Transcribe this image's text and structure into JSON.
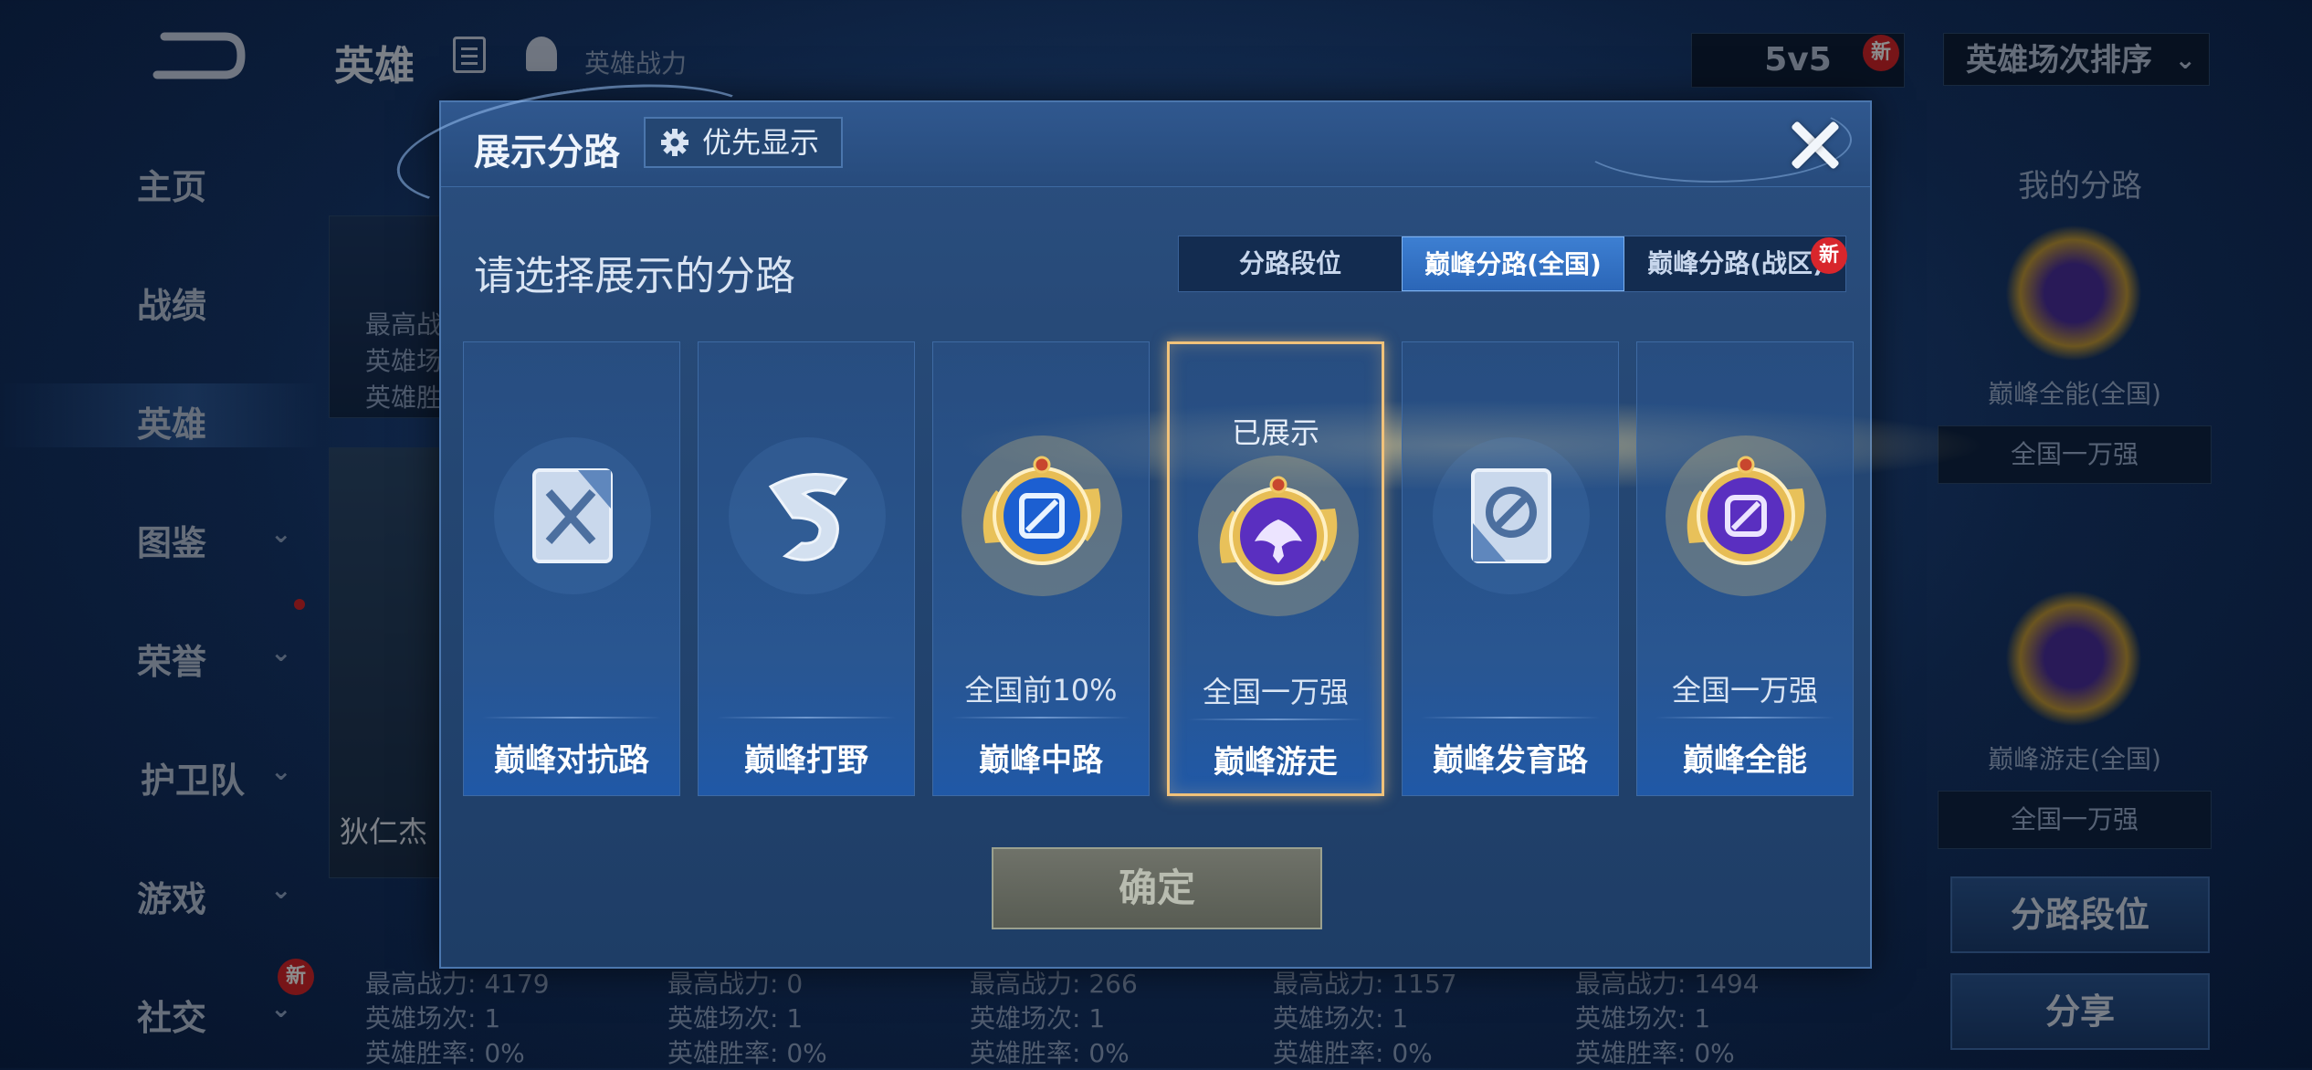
{
  "topbar": {
    "title": "英雄",
    "power_label": "英雄战力",
    "mode": "5v5",
    "mode_badge": "新",
    "sort_label": "英雄场次排序",
    "sort_chevron": "⌄"
  },
  "sidebar": {
    "items": [
      {
        "label": "主页"
      },
      {
        "label": "战绩"
      },
      {
        "label": "英雄"
      },
      {
        "label": "图鉴",
        "chevron": "⌄"
      },
      {
        "label": "荣誉",
        "chevron": "⌄"
      },
      {
        "label": "护卫队",
        "chevron": "⌄"
      },
      {
        "label": "游戏",
        "chevron": "⌄"
      },
      {
        "label": "社交",
        "chevron": "⌄"
      }
    ],
    "social_badge": "新"
  },
  "background_cards": {
    "top_card_stats": [
      "最高战",
      "英雄场",
      "英雄胜"
    ],
    "hero_name": "狄仁杰",
    "stats": [
      [
        "最高战力: 4179",
        "英雄场次: 1",
        "英雄胜率: 0%"
      ],
      [
        "最高战力: 0",
        "英雄场次: 1",
        "英雄胜率: 0%"
      ],
      [
        "最高战力: 266",
        "英雄场次: 1",
        "英雄胜率: 0%"
      ],
      [
        "最高战力: 1157",
        "英雄场次: 1",
        "英雄胜率: 0%"
      ],
      [
        "最高战力: 1494",
        "英雄场次: 1",
        "英雄胜率: 0%"
      ]
    ]
  },
  "right_panel": {
    "title": "我的分路",
    "slots": [
      {
        "name": "巅峰全能(全国)",
        "rank": "全国一万强"
      },
      {
        "name": "巅峰游走(全国)",
        "rank": "全国一万强"
      }
    ],
    "lane_rank_button": "分路段位",
    "share_button": "分享"
  },
  "modal": {
    "title": "展示分路",
    "priority_label": "优先显示",
    "prompt": "请选择展示的分路",
    "tabs": [
      {
        "label": "分路段位",
        "active": false
      },
      {
        "label": "巅峰分路(全国)",
        "active": true
      },
      {
        "label": "巅峰分路(战区)",
        "active": false
      }
    ],
    "tab_new_badge": "新",
    "lanes": [
      {
        "name": "巅峰对抗路",
        "rank": "",
        "shown": "",
        "style": "plain",
        "icon": "sword-cross-icon"
      },
      {
        "name": "巅峰打野",
        "rank": "",
        "shown": "",
        "style": "plain",
        "icon": "dragon-icon"
      },
      {
        "name": "巅峰中路",
        "rank": "全国前10%",
        "shown": "",
        "style": "gold-blue",
        "icon": "mid-lane-icon"
      },
      {
        "name": "巅峰游走",
        "rank": "全国一万强",
        "shown": "已展示",
        "style": "gold-purple",
        "icon": "support-wings-icon",
        "selected": true
      },
      {
        "name": "巅峰发育路",
        "rank": "",
        "shown": "",
        "style": "plain",
        "icon": "marksman-icon"
      },
      {
        "name": "巅峰全能",
        "rank": "全国一万强",
        "shown": "",
        "style": "gold-purple",
        "icon": "all-round-icon"
      }
    ],
    "confirm_label": "确定"
  },
  "colors": {
    "accent": "#3d7fd2",
    "selected_border": "#f1c27a",
    "badge_red": "#d8262c",
    "confirm_disabled": "#585c53"
  }
}
